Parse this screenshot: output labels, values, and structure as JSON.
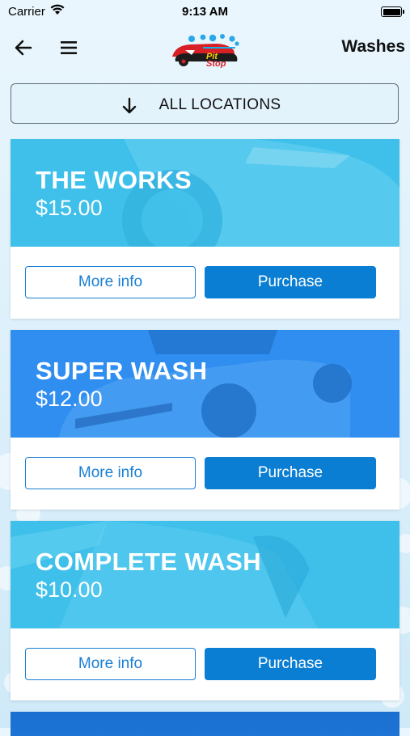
{
  "status_bar": {
    "carrier": "Carrier",
    "time": "9:13 AM"
  },
  "nav": {
    "title": "Washes",
    "logo_text": "Pit Stop"
  },
  "location_filter": {
    "label": "ALL LOCATIONS"
  },
  "washes": [
    {
      "name": "THE WORKS",
      "price": "$15.00",
      "more_info_label": "More info",
      "purchase_label": "Purchase",
      "color": "#3ec0ea"
    },
    {
      "name": "SUPER WASH",
      "price": "$12.00",
      "more_info_label": "More info",
      "purchase_label": "Purchase",
      "color": "#2f8ef0"
    },
    {
      "name": "COMPLETE WASH",
      "price": "$10.00",
      "more_info_label": "More info",
      "purchase_label": "Purchase",
      "color": "#3ec0ea"
    }
  ],
  "colors": {
    "accent": "#0a7ed3",
    "outline": "#1a7fd4"
  },
  "icons": {
    "back": "arrow-left-icon",
    "menu": "hamburger-icon",
    "filter": "arrow-down-icon"
  }
}
